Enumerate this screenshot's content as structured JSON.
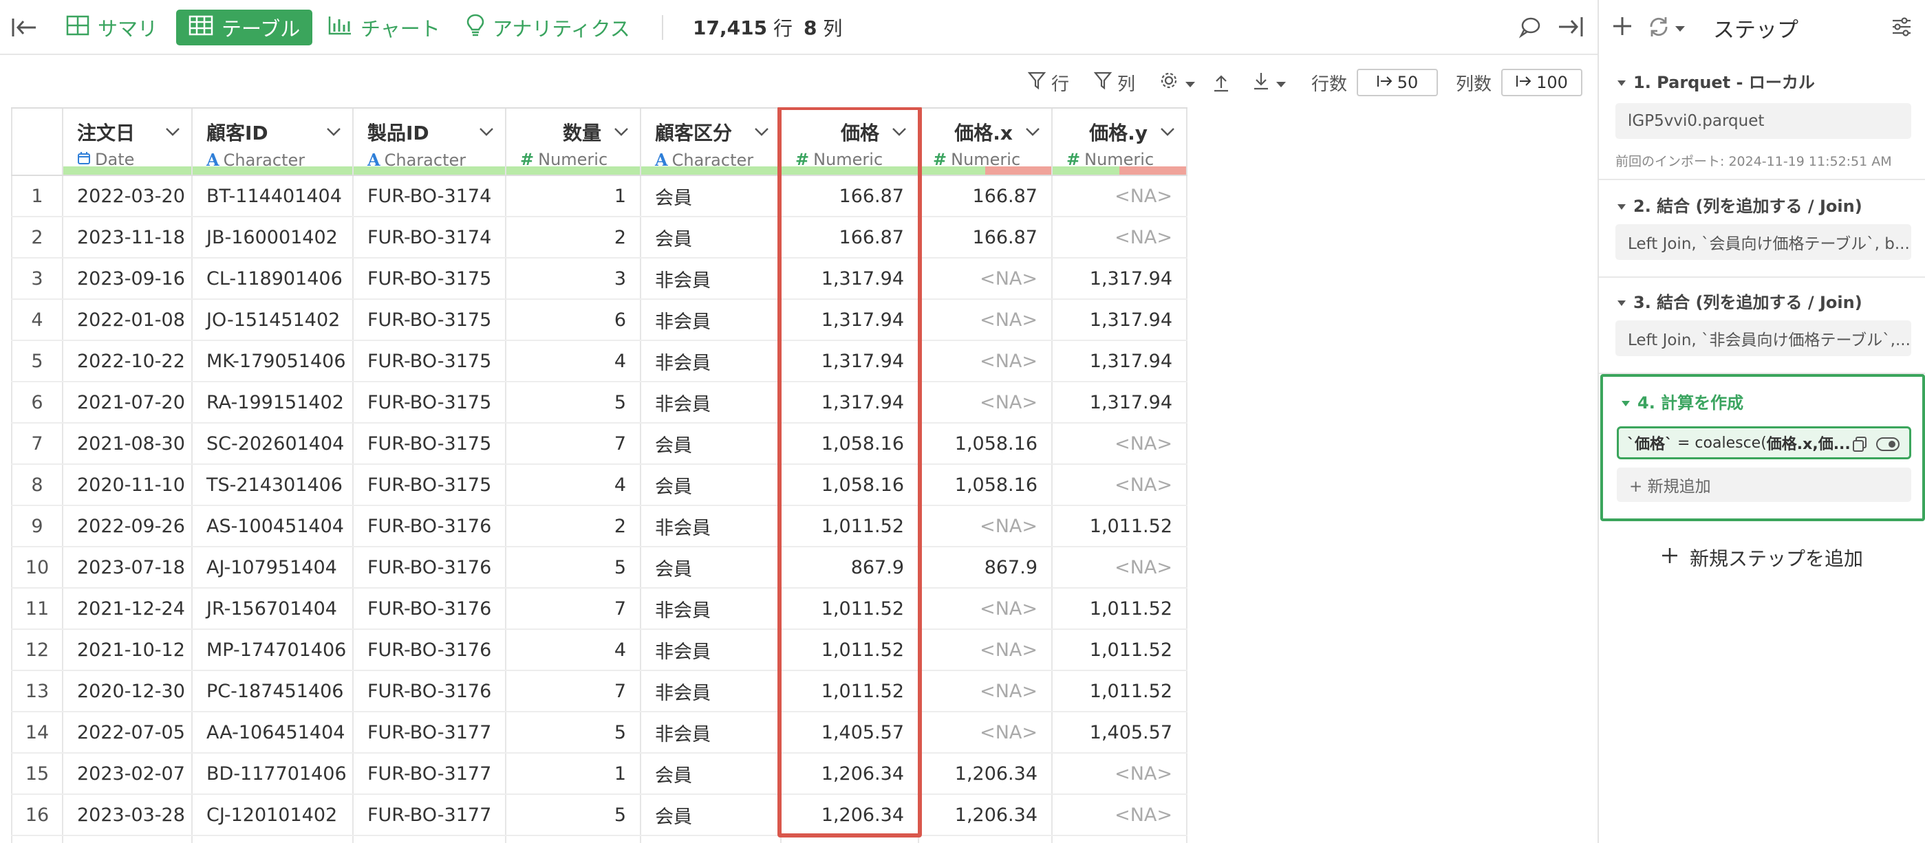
{
  "toolbar": {
    "tabs": [
      {
        "label": "サマリ",
        "icon": "summary-grid-icon"
      },
      {
        "label": "テーブル",
        "icon": "table-icon",
        "active": true
      },
      {
        "label": "チャート",
        "icon": "bar-chart-icon"
      },
      {
        "label": "アナリティクス",
        "icon": "lightbulb-icon"
      }
    ],
    "row_count": "17,415",
    "row_unit": "行",
    "col_count": "8",
    "col_unit": "列"
  },
  "subbar": {
    "row_filter_label": "行",
    "col_filter_label": "列",
    "rows_label": "行数",
    "rows_value": "50",
    "cols_label": "列数",
    "cols_value": "100"
  },
  "table": {
    "columns": [
      {
        "name": "注文日",
        "type": "Date",
        "type_icon": "calendar-icon",
        "quality_bad": 0
      },
      {
        "name": "顧客ID",
        "type": "Character",
        "type_icon": "character-icon",
        "quality_bad": 0
      },
      {
        "name": "製品ID",
        "type": "Character",
        "type_icon": "character-icon",
        "quality_bad": 0
      },
      {
        "name": "数量",
        "type": "Numeric",
        "type_icon": "numeric-icon",
        "quality_bad": 0
      },
      {
        "name": "顧客区分",
        "type": "Character",
        "type_icon": "character-icon",
        "quality_bad": 0
      },
      {
        "name": "価格",
        "type": "Numeric",
        "type_icon": "numeric-icon",
        "quality_bad": 0
      },
      {
        "name": "価格.x",
        "type": "Numeric",
        "type_icon": "numeric-icon",
        "quality_bad": 0.5
      },
      {
        "name": "価格.y",
        "type": "Numeric",
        "type_icon": "numeric-icon",
        "quality_bad": 0.5
      }
    ],
    "rows": [
      [
        "1",
        "2022-03-20",
        "BT-114401404",
        "FUR-BO-3174",
        "1",
        "会員",
        "166.87",
        "166.87",
        "<NA>"
      ],
      [
        "2",
        "2023-11-18",
        "JB-160001402",
        "FUR-BO-3174",
        "2",
        "会員",
        "166.87",
        "166.87",
        "<NA>"
      ],
      [
        "3",
        "2023-09-16",
        "CL-118901406",
        "FUR-BO-3175",
        "3",
        "非会員",
        "1,317.94",
        "<NA>",
        "1,317.94"
      ],
      [
        "4",
        "2022-01-08",
        "JO-151451402",
        "FUR-BO-3175",
        "6",
        "非会員",
        "1,317.94",
        "<NA>",
        "1,317.94"
      ],
      [
        "5",
        "2022-10-22",
        "MK-179051406",
        "FUR-BO-3175",
        "4",
        "非会員",
        "1,317.94",
        "<NA>",
        "1,317.94"
      ],
      [
        "6",
        "2021-07-20",
        "RA-199151402",
        "FUR-BO-3175",
        "5",
        "非会員",
        "1,317.94",
        "<NA>",
        "1,317.94"
      ],
      [
        "7",
        "2021-08-30",
        "SC-202601404",
        "FUR-BO-3175",
        "7",
        "会員",
        "1,058.16",
        "1,058.16",
        "<NA>"
      ],
      [
        "8",
        "2020-11-10",
        "TS-214301406",
        "FUR-BO-3175",
        "4",
        "会員",
        "1,058.16",
        "1,058.16",
        "<NA>"
      ],
      [
        "9",
        "2022-09-26",
        "AS-100451404",
        "FUR-BO-3176",
        "2",
        "非会員",
        "1,011.52",
        "<NA>",
        "1,011.52"
      ],
      [
        "10",
        "2023-07-18",
        "AJ-107951404",
        "FUR-BO-3176",
        "5",
        "会員",
        "867.9",
        "867.9",
        "<NA>"
      ],
      [
        "11",
        "2021-12-24",
        "JR-156701404",
        "FUR-BO-3176",
        "7",
        "非会員",
        "1,011.52",
        "<NA>",
        "1,011.52"
      ],
      [
        "12",
        "2021-10-12",
        "MP-174701406",
        "FUR-BO-3176",
        "4",
        "非会員",
        "1,011.52",
        "<NA>",
        "1,011.52"
      ],
      [
        "13",
        "2020-12-30",
        "PC-187451406",
        "FUR-BO-3176",
        "7",
        "非会員",
        "1,011.52",
        "<NA>",
        "1,011.52"
      ],
      [
        "14",
        "2022-07-05",
        "AA-106451404",
        "FUR-BO-3177",
        "5",
        "非会員",
        "1,405.57",
        "<NA>",
        "1,405.57"
      ],
      [
        "15",
        "2023-02-07",
        "BD-117701406",
        "FUR-BO-3177",
        "1",
        "会員",
        "1,206.34",
        "1,206.34",
        "<NA>"
      ],
      [
        "16",
        "2023-03-28",
        "CJ-120101402",
        "FUR-BO-3177",
        "5",
        "会員",
        "1,206.34",
        "1,206.34",
        "<NA>"
      ],
      [
        "",
        "",
        "",
        "",
        "",
        "",
        "",
        "",
        ""
      ]
    ]
  },
  "panel": {
    "title": "ステップ",
    "steps": [
      {
        "title": "1. Parquet - ローカル",
        "detail": "lGP5vvi0.parquet",
        "note": "前回のインポート: 2024-11-19 11:52:51 AM"
      },
      {
        "title": "2. 結合 (列を追加する / Join)",
        "detail": "Left Join, `会員向け価格テーブル`, b..."
      },
      {
        "title": "3. 結合 (列を追加する / Join)",
        "detail": "Left Join, `非会員向け価格テーブル`,..."
      },
      {
        "title": "4. 計算を作成",
        "calc_name": "`価格`",
        "calc_expr": " = coalesce(",
        "calc_args": "価格.x,価...",
        "add_new": "+ 新規追加"
      }
    ],
    "add_step_label": "新規ステップを追加"
  },
  "colors": {
    "accent_green": "#3ba55c",
    "highlight_red": "#d9574c",
    "quality_ok": "#b9eaa7",
    "quality_bad": "#f0a39a"
  }
}
